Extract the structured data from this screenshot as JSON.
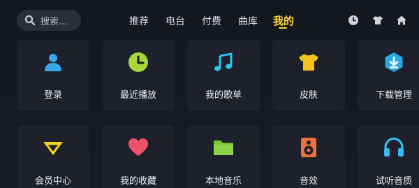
{
  "search": {
    "placeholder": "搜索..."
  },
  "nav": {
    "tabs": [
      {
        "label": "推荐"
      },
      {
        "label": "电台"
      },
      {
        "label": "付费"
      },
      {
        "label": "曲库"
      },
      {
        "label": "我的",
        "active": true
      }
    ]
  },
  "top_icons": [
    "clock-icon",
    "shirt-icon",
    "home-icon"
  ],
  "grid": {
    "row1": [
      {
        "label": "登录",
        "icon": "user-icon"
      },
      {
        "label": "最近播放",
        "icon": "clock-icon"
      },
      {
        "label": "我的歌单",
        "icon": "music-note-icon"
      },
      {
        "label": "皮肤",
        "icon": "shirt-icon"
      },
      {
        "label": "下载管理",
        "icon": "download-icon"
      }
    ],
    "row2": [
      {
        "label": "会员中心",
        "icon": "vip-diamond-icon"
      },
      {
        "label": "我的收藏",
        "icon": "heart-icon"
      },
      {
        "label": "本地音乐",
        "icon": "folder-icon"
      },
      {
        "label": "音效",
        "icon": "speaker-icon"
      },
      {
        "label": "试听音质",
        "icon": "headphones-icon"
      }
    ]
  },
  "colors": {
    "accent": "#ffd83a",
    "background": "#15171e",
    "card": "#1e212b",
    "user": "#3aa8e8",
    "recent": "#a6d63a",
    "music": "#2ec4f0",
    "shirt": "#f5c21b",
    "download": "#29a8e0",
    "vip": "#f5d21b",
    "heart": "#f0506a",
    "folder": "#7cc63a",
    "speaker": "#f0713a",
    "headphones": "#3ab8f0"
  }
}
